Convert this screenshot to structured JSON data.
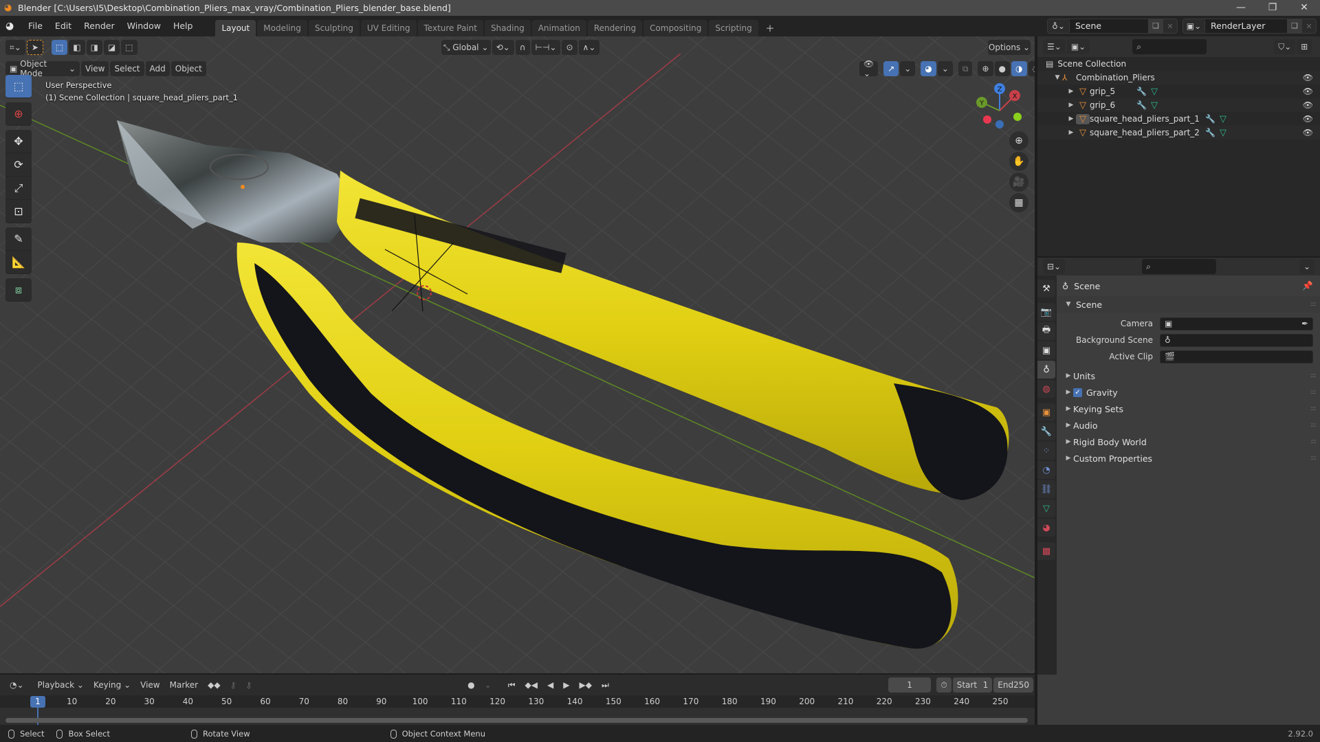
{
  "window": {
    "title": "Blender [C:\\Users\\I5\\Desktop\\Combination_Pliers_max_vray/Combination_Pliers_blender_base.blend]",
    "controls": [
      "minimize",
      "maximize",
      "close"
    ]
  },
  "menubar": {
    "items": [
      "File",
      "Edit",
      "Render",
      "Window",
      "Help"
    ]
  },
  "workspaces": {
    "tabs": [
      "Layout",
      "Modeling",
      "Sculpting",
      "UV Editing",
      "Texture Paint",
      "Shading",
      "Animation",
      "Rendering",
      "Compositing",
      "Scripting"
    ],
    "active": "Layout",
    "add_label": "+"
  },
  "scene_selector": {
    "value": "Scene"
  },
  "layer_selector": {
    "value": "RenderLayer"
  },
  "viewport": {
    "orientation": "Global",
    "options_label": "Options",
    "mode": "Object Mode",
    "menus": [
      "View",
      "Select",
      "Add",
      "Object"
    ],
    "overlay_line1": "User Perspective",
    "overlay_line2": "(1) Scene Collection | square_head_pliers_part_1",
    "axes": {
      "x": "X",
      "y": "Y",
      "z": "Z"
    },
    "colors": {
      "x_axis": "#c8404a",
      "y_axis": "#6a9a2a",
      "z_axis": "#3f7fe0",
      "grip_yellow": "#e6d516",
      "grip_black": "#111216",
      "accent": "#4772b3"
    },
    "tools": [
      "select-box",
      "cursor",
      "move",
      "rotate",
      "scale",
      "transform",
      "annotate",
      "measure",
      "add-cube"
    ],
    "nav_buttons": [
      "zoom",
      "pan",
      "camera",
      "ortho-toggle"
    ]
  },
  "outliner": {
    "root": "Scene Collection",
    "collection": "Combination_Pliers",
    "objects": [
      {
        "name": "grip_5"
      },
      {
        "name": "grip_6"
      },
      {
        "name": "square_head_pliers_part_1"
      },
      {
        "name": "square_head_pliers_part_2"
      }
    ]
  },
  "properties": {
    "context": "Scene",
    "panel_title": "Scene",
    "fields": [
      {
        "label": "Camera",
        "value": ""
      },
      {
        "label": "Background Scene",
        "value": ""
      },
      {
        "label": "Active Clip",
        "value": ""
      }
    ],
    "subpanels": [
      {
        "label": "Units"
      },
      {
        "label": "Gravity",
        "checked": true
      },
      {
        "label": "Keying Sets"
      },
      {
        "label": "Audio"
      },
      {
        "label": "Rigid Body World"
      },
      {
        "label": "Custom Properties"
      }
    ]
  },
  "timeline": {
    "menus": [
      "Playback",
      "Keying",
      "View",
      "Marker"
    ],
    "current_frame": "1",
    "start_label": "Start",
    "start": "1",
    "end_label": "End",
    "end": "250",
    "ticks": [
      "10",
      "20",
      "30",
      "40",
      "50",
      "60",
      "70",
      "80",
      "90",
      "100",
      "110",
      "120",
      "130",
      "140",
      "150",
      "160",
      "170",
      "180",
      "190",
      "200",
      "210",
      "220",
      "230",
      "240",
      "250"
    ]
  },
  "statusbar": {
    "items": [
      "Select",
      "Box Select",
      "Rotate View",
      "Object Context Menu"
    ],
    "version": "2.92.0"
  }
}
